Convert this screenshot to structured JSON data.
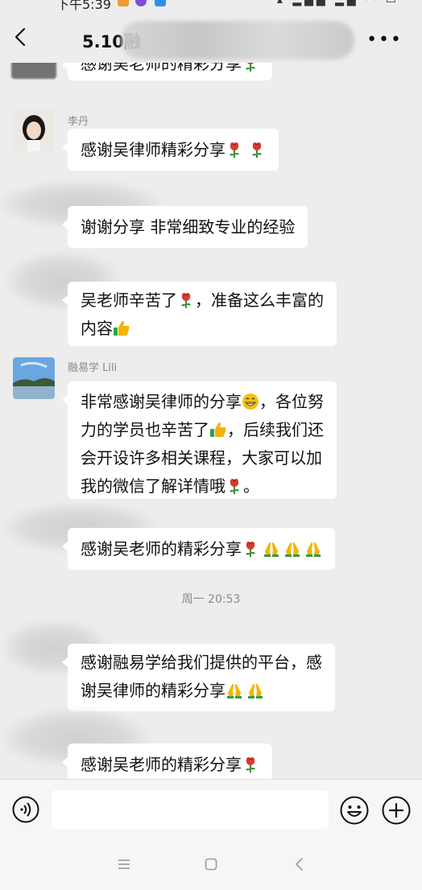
{
  "status_bar": {
    "time": "下午5:39"
  },
  "header": {
    "title": "5.10融"
  },
  "messages": [
    {
      "sender": "",
      "text": "感谢吴老师的精彩分享",
      "emojis": [
        "rose"
      ]
    },
    {
      "sender": "李丹",
      "text": "感谢吴律师精彩分享",
      "emojis": [
        "rose",
        "rose"
      ]
    },
    {
      "sender": "",
      "text": "谢谢分享 非常细致专业的经验",
      "emojis": []
    },
    {
      "sender": "",
      "line1_before": "吴老师辛苦了",
      "line1_after": "，准备这么丰富的",
      "line2": "内容",
      "emojis": [
        "rose",
        "thumbs-up"
      ]
    },
    {
      "sender": "融易学 Lili",
      "line1_text": "非常感谢吴律师的分享",
      "line1_after": "，各位努",
      "line2_before": "力的学员也辛苦了",
      "line2_after": "，后续我们还",
      "line3": "会开设许多相关课程，大家可以加",
      "line4_before": "我的微信了解详情哦",
      "line4_after": "。",
      "emojis": [
        "grin",
        "thumbs-up",
        "rose"
      ]
    },
    {
      "sender": "",
      "text": "感谢吴老师的精彩分享",
      "emojis": [
        "rose",
        "pray",
        "pray",
        "pray"
      ]
    },
    {
      "sender": "",
      "line1": "感谢融易学给我们提供的平台，感",
      "line2": "谢吴律师的精彩分享",
      "emojis": [
        "pray",
        "pray"
      ]
    },
    {
      "sender": "",
      "text": "感谢吴老师的精彩分享",
      "emojis": [
        "rose"
      ]
    }
  ],
  "timestamp": "周一 20:53",
  "input": {
    "placeholder": ""
  },
  "icons": {
    "back": "back-icon",
    "more": "more-icon",
    "voice": "voice-icon",
    "emoji": "emoji-icon",
    "plus": "plus-icon",
    "sys_menu": "menu-icon",
    "sys_home": "home-icon",
    "sys_back": "back-icon"
  },
  "colors": {
    "background": "#ededed",
    "bubble": "#ffffff",
    "rose": "#d83a2f",
    "thumb": "#f4b400"
  }
}
